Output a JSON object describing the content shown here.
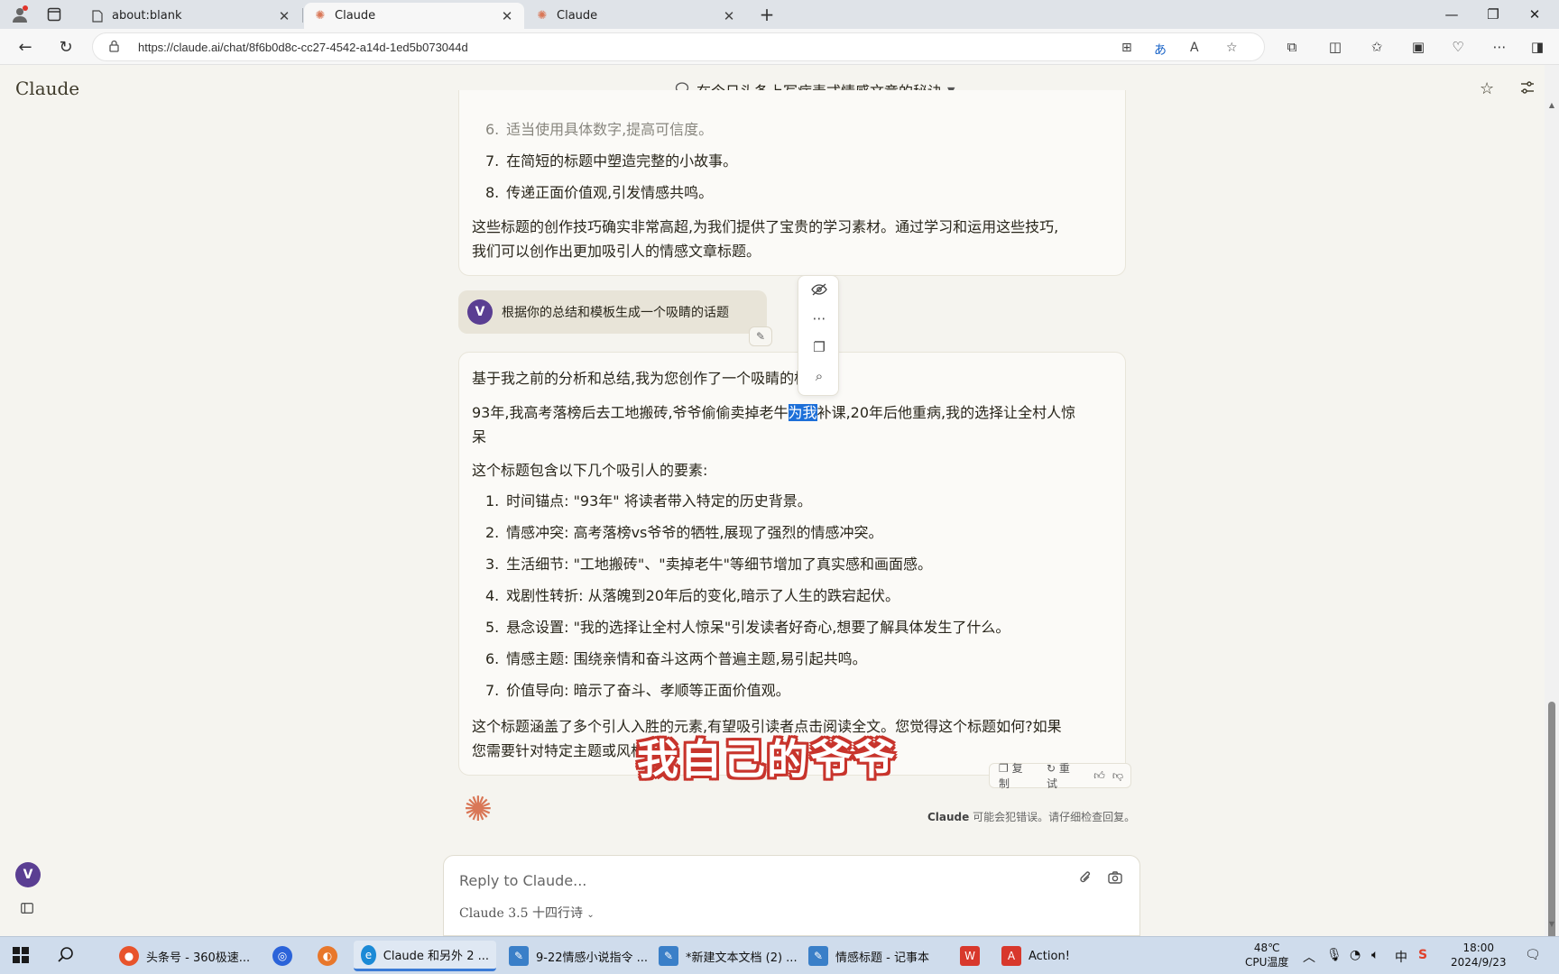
{
  "browser": {
    "tabs": [
      {
        "title": "about:blank",
        "favicon": "page-icon",
        "active": false
      },
      {
        "title": "Claude",
        "favicon": "claude-icon",
        "active": true
      },
      {
        "title": "Claude",
        "favicon": "claude-icon",
        "active": false
      }
    ],
    "url": "https://claude.ai/chat/8f6b0d8c-cc27-4542-a14d-1ed5b073044d"
  },
  "app": {
    "brand": "Claude",
    "chat_title": "在今日头条上写病毒式情感文章的秘诀"
  },
  "prev_response": {
    "items": [
      {
        "num": "6.",
        "text": "适当使用具体数字,提高可信度。"
      },
      {
        "num": "7.",
        "text": "在简短的标题中塑造完整的小故事。"
      },
      {
        "num": "8.",
        "text": "传递正面价值观,引发情感共鸣。"
      }
    ],
    "summary_line1": "这些标题的创作技巧确实非常高超,为我们提供了宝贵的学习素材。通过学习和运用这些技巧,",
    "summary_line2": "我们可以创作出更加吸引人的情感文章标题。"
  },
  "user_message": {
    "avatar_letter": "V",
    "text": "根据你的总结和模板生成一个吸睛的话题"
  },
  "response": {
    "intro": "基于我之前的分析和总结,我为您创作了一个吸睛的标题:",
    "headline_before": "93年,我高考落榜后去工地搬砖,爷爷偷偷卖掉老牛",
    "headline_selected": "为我",
    "headline_after": "补课,20年后他重病,我的选择让全村人惊",
    "headline_wrap": "呆",
    "elements_intro": "这个标题包含以下几个吸引人的要素:",
    "items": [
      {
        "num": "1.",
        "text": "时间锚点: \"93年\" 将读者带入特定的历史背景。"
      },
      {
        "num": "2.",
        "text": "情感冲突: 高考落榜vs爷爷的牺牲,展现了强烈的情感冲突。"
      },
      {
        "num": "3.",
        "text": "生活细节: \"工地搬砖\"、\"卖掉老牛\"等细节增加了真实感和画面感。"
      },
      {
        "num": "4.",
        "text": "戏剧性转折: 从落魄到20年后的变化,暗示了人生的跌宕起伏。"
      },
      {
        "num": "5.",
        "text": "悬念设置: \"我的选择让全村人惊呆\"引发读者好奇心,想要了解具体发生了什么。"
      },
      {
        "num": "6.",
        "text": "情感主题: 围绕亲情和奋斗这两个普遍主题,易引起共鸣。"
      },
      {
        "num": "7.",
        "text": "价值导向: 暗示了奋斗、孝顺等正面价值观。"
      }
    ],
    "closing_line1": "这个标题涵盖了多个引人入胜的元素,有望吸引读者点击阅读全文。您觉得这个标题如何?如果",
    "closing_line2": "您需要针对特定主题或风格"
  },
  "message_actions": {
    "copy": "复制",
    "retry": "重试"
  },
  "disclaimer": {
    "brand": "Claude",
    "text": "可能会犯错误。请仔细检查回复。"
  },
  "overlay_caption": "我自己的爷爷",
  "composer": {
    "placeholder": "Reply to Claude...",
    "model": "Claude 3.5 十四行诗"
  },
  "sidebar": {
    "avatar_letter": "V"
  },
  "taskbar": {
    "apps": [
      {
        "label": "头条号 - 360极速...",
        "color": "#e8532b"
      },
      {
        "label": "",
        "color": "#2b63d9"
      },
      {
        "label": "",
        "color": "#e8772b"
      },
      {
        "label": "Claude 和另外 2 ...",
        "color": "#1b8ad6"
      },
      {
        "label": "9-22情感小说指令 ...",
        "color": "#3a7fc8"
      },
      {
        "label": "*新建文本文档 (2) ...",
        "color": "#3a7fc8"
      },
      {
        "label": "情感标题 - 记事本",
        "color": "#3a7fc8"
      },
      {
        "label": "",
        "color": "#d8382c"
      },
      {
        "label": "Action!",
        "color": "#d8382c"
      }
    ],
    "temperature": "48℃",
    "temperature_label": "CPU温度",
    "ime": "中",
    "time": "18:00",
    "date": "2024/9/23"
  }
}
